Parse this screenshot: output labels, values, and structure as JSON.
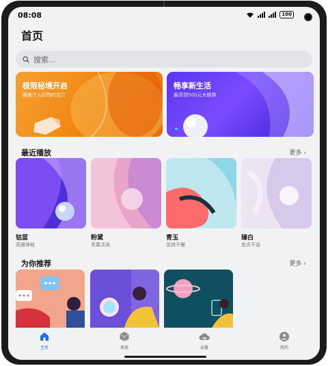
{
  "status_bar": {
    "time": "08:08",
    "battery": "100"
  },
  "page_title": "首页",
  "search": {
    "placeholder": "搜索..."
  },
  "banners": [
    {
      "title": "极限秘境开启",
      "subtitle": "藏着什么好物的宝贝"
    },
    {
      "title": "畅享新生活",
      "subtitle": "最高领500元大额券"
    }
  ],
  "recent": {
    "title": "最近播放",
    "more": "更多",
    "items": [
      {
        "name": "钴蓝",
        "desc": "高雅神秘"
      },
      {
        "name": "粉黛",
        "desc": "青春活泼"
      },
      {
        "name": "青玉",
        "desc": "坚持不懈"
      },
      {
        "name": "臻白",
        "desc": "忠贞不渝"
      }
    ]
  },
  "recommend": {
    "title": "为你推荐",
    "more": "更多"
  },
  "tabs": [
    {
      "label": "主页",
      "icon": "home-icon",
      "active": true
    },
    {
      "label": "发现",
      "icon": "discover-icon"
    },
    {
      "label": "云盘",
      "icon": "cloud-icon"
    },
    {
      "label": "我的",
      "icon": "profile-icon"
    }
  ],
  "colors": {
    "accent": "#1f6ff0",
    "background": "#f1f2f4"
  }
}
